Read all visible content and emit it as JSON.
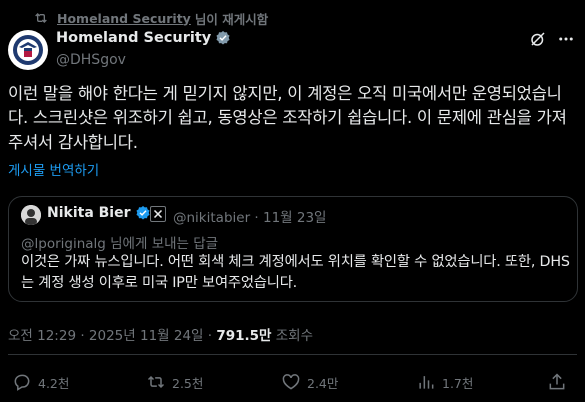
{
  "retweet": {
    "name": "Homeland Security",
    "suffix": "님이 재게시함"
  },
  "author": {
    "name": "Homeland Security",
    "handle": "@DHSgov"
  },
  "tweet": {
    "text": "이런 말을 해야 한다는 게 믿기지 않지만, 이 계정은 오직 미국에서만 운영되었습니다. 스크린샷은 위조하기 쉽고, 동영상은 조작하기 쉽습니다. 이 문제에 관심을 가져주셔서 감사합니다.",
    "translate_label": "게시물 번역하기"
  },
  "quote": {
    "name": "Nikita Bier",
    "handle_date": "@nikitabier · 11월 23일",
    "replying": "@lporiginalg 님에게 보내는 답글",
    "text": "이것은 가짜 뉴스입니다. 어떤 회색 체크 계정에서도 위치를 확인할 수 없었습니다. 또한, DHS는 계정 생성 이후로 미국 IP만 보여주었습니다."
  },
  "meta": {
    "timestamp": "오전 12:29 · 2025년 11월 24일 · ",
    "views_count": "791.5만",
    "views_label": " 조회수"
  },
  "actions": {
    "reply_count": "4.2천",
    "repost_count": "2.5천",
    "like_count": "2.4만",
    "bookmark_count": "1.7천"
  },
  "colors": {
    "background": "#000000",
    "text": "#e7e9ea",
    "muted": "#71767b",
    "link": "#1d9bf0",
    "border": "#2f3336"
  }
}
